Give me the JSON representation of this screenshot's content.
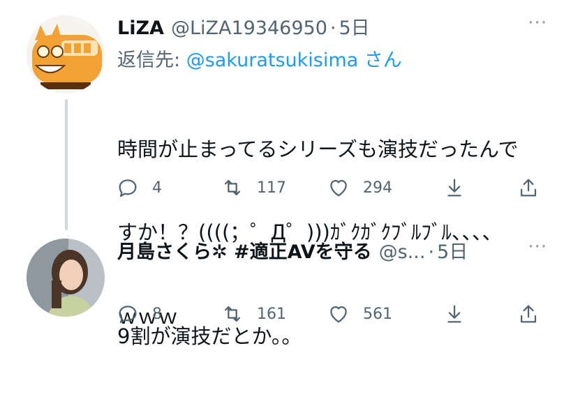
{
  "tweets": [
    {
      "name": "LiZA",
      "handle": "@LiZA19346950",
      "dot": "·",
      "time": "5日",
      "more": "···",
      "reply_prefix": "返信先: ",
      "reply_handle": "@sakuratsukisima",
      "reply_suffix": " さん",
      "text_line1": "時間が止まってるシリーズも演技だったんで",
      "text_line2": "すか！？((((；゜Д゜)))ｶﾞｸｶﾞｸﾌﾞﾙﾌﾞﾙ、、、、",
      "text_line3": "ｗｗｗ",
      "replies": "4",
      "retweets": "117",
      "likes": "294",
      "avatar_icon": "catbus-avatar"
    },
    {
      "name": "月島さくら✲ #適正AVを守る",
      "handle": "@s...",
      "dot": "·",
      "time": "5日",
      "more": "···",
      "text_line1": "9割が演技だとか。。",
      "replies": "8",
      "retweets": "161",
      "likes": "561",
      "avatar_icon": "profile-photo-avatar"
    }
  ],
  "colors": {
    "text": "#0f1419",
    "secondary": "#536471",
    "link": "#1d9bf0",
    "thread_line": "#cfd9de"
  }
}
